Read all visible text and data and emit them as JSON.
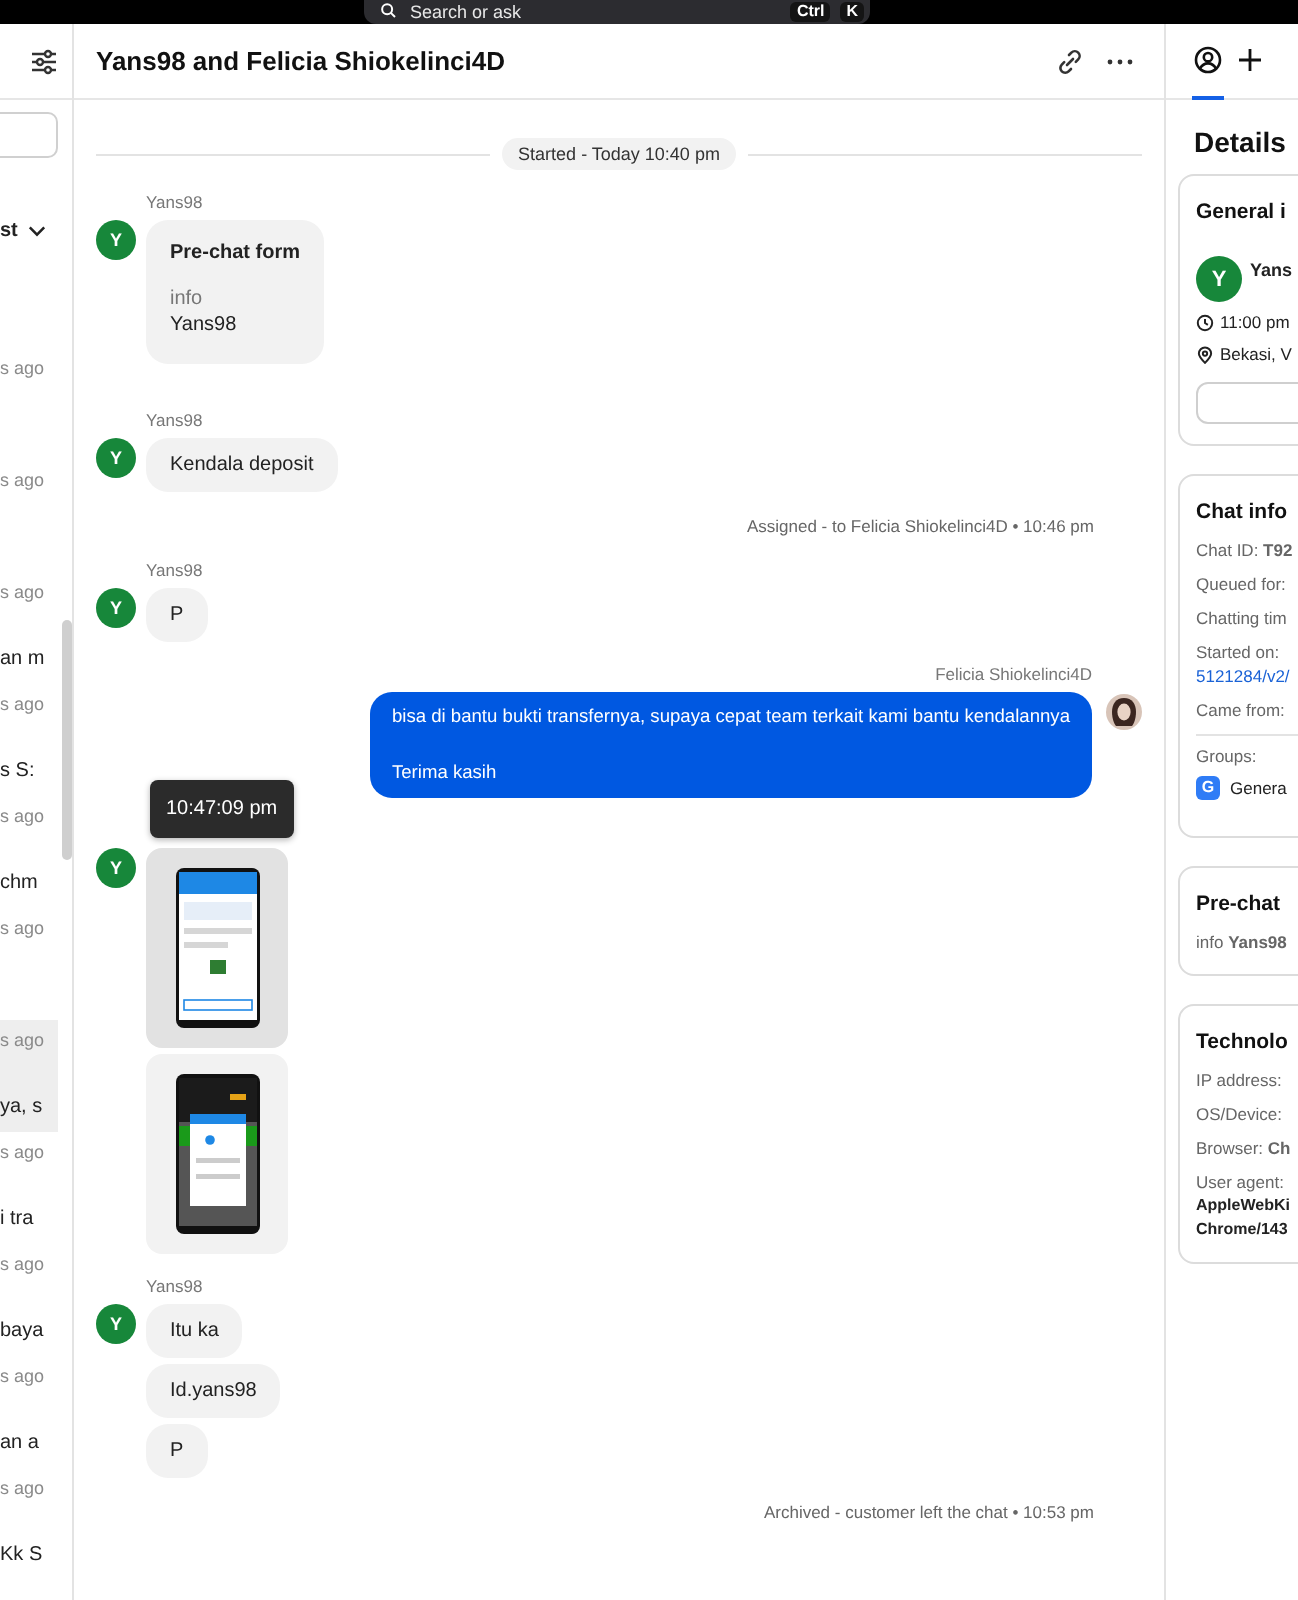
{
  "top_bar": {
    "search": {
      "placeholder": "Search or ask"
    },
    "shortcut_keys": [
      "Ctrl",
      "K"
    ]
  },
  "conversation_list": {
    "sort": {
      "label": "st"
    },
    "items": [
      {
        "time": "s ago",
        "selected": false
      },
      {
        "time": "s ago",
        "selected": false
      },
      {
        "time": "s ago",
        "preview": "an m",
        "selected": false
      },
      {
        "time": "s ago",
        "preview": "s S:",
        "selected": false
      },
      {
        "time": "s ago",
        "preview": "chm",
        "selected": false
      },
      {
        "time": "s ago",
        "selected": false
      },
      {
        "time": "s ago",
        "preview": "ya, s",
        "selected": true
      },
      {
        "time": "s ago",
        "preview": "i tra",
        "selected": false
      },
      {
        "time": "s ago",
        "preview": "baya",
        "selected": false
      },
      {
        "time": "s ago",
        "preview": "an a",
        "selected": false
      },
      {
        "time": "s ago",
        "preview": "Kk S",
        "selected": false
      }
    ]
  },
  "chat": {
    "title": "Yans98 and Felicia Shiokelinci4D",
    "events": [
      {
        "kind": "divider",
        "text": "Started - Today 10:40 pm"
      },
      {
        "kind": "customer",
        "sender": "Yans98",
        "avatar": "Y",
        "messages": [
          {
            "kind": "form",
            "title": "Pre-chat form",
            "field": "info",
            "value": "Yans98"
          }
        ]
      },
      {
        "kind": "customer",
        "sender": "Yans98",
        "avatar": "Y",
        "messages": [
          {
            "kind": "text",
            "text": "Kendala deposit"
          }
        ]
      },
      {
        "kind": "note",
        "text": "Assigned - to Felicia Shiokelinci4D • 10:46 pm"
      },
      {
        "kind": "customer",
        "sender": "Yans98",
        "avatar": "Y",
        "messages": [
          {
            "kind": "text",
            "text": "P"
          }
        ]
      },
      {
        "kind": "agent",
        "sender": "Felicia Shiokelinci4D",
        "messages": [
          {
            "kind": "text",
            "text": "bisa di bantu bukti transfernya, supaya cepat team terkait kami bantu kendalannya\n\nTerima kasih"
          }
        ]
      },
      {
        "kind": "customer",
        "avatar": "Y",
        "tooltip": "10:47:09 pm",
        "messages": [
          {
            "kind": "image_light",
            "hovered": true
          },
          {
            "kind": "image_dark",
            "hovered": false
          }
        ]
      },
      {
        "kind": "customer",
        "sender": "Yans98",
        "avatar": "Y",
        "messages": [
          {
            "kind": "text",
            "text": "Itu ka"
          },
          {
            "kind": "text",
            "text": "Id.yans98"
          },
          {
            "kind": "text",
            "text": "P"
          }
        ]
      },
      {
        "kind": "note",
        "text": "Archived - customer left the chat • 10:53 pm"
      }
    ]
  },
  "details": {
    "tabs": [
      {
        "kind": "person",
        "selected": true
      },
      {
        "kind": "plus",
        "selected": false
      }
    ],
    "title": "Details",
    "cards": [
      {
        "kind": "profile",
        "title": "General i",
        "avatar": "Y",
        "name": "Yans",
        "facts": [
          {
            "kind": "time",
            "text": "11:00 pm"
          },
          {
            "kind": "location",
            "text": "Bekasi, V"
          }
        ]
      },
      {
        "kind": "fields",
        "title": "Chat info",
        "rows": [
          {
            "label": "Chat ID:",
            "value": "T92"
          },
          {
            "label": "Queued for:"
          },
          {
            "label": "Chatting tim"
          },
          {
            "label": "Started on:",
            "link": "5121284/v2/"
          },
          {
            "label": "Came from:"
          }
        ],
        "groups": {
          "label": "Groups:",
          "items": [
            {
              "badge": "G",
              "name": "Genera"
            }
          ]
        }
      },
      {
        "kind": "fields",
        "title": "Pre-chat",
        "rows": [
          {
            "label": "info",
            "value": "Yans98"
          }
        ]
      },
      {
        "kind": "fields",
        "title": "Technolo",
        "rows": [
          {
            "label": "IP address:"
          },
          {
            "label": "OS/Device:"
          },
          {
            "label": "Browser:",
            "value": "Ch"
          },
          {
            "label": "User agent:",
            "lines": [
              "AppleWebKi",
              "Chrome/143"
            ]
          }
        ]
      }
    ]
  }
}
